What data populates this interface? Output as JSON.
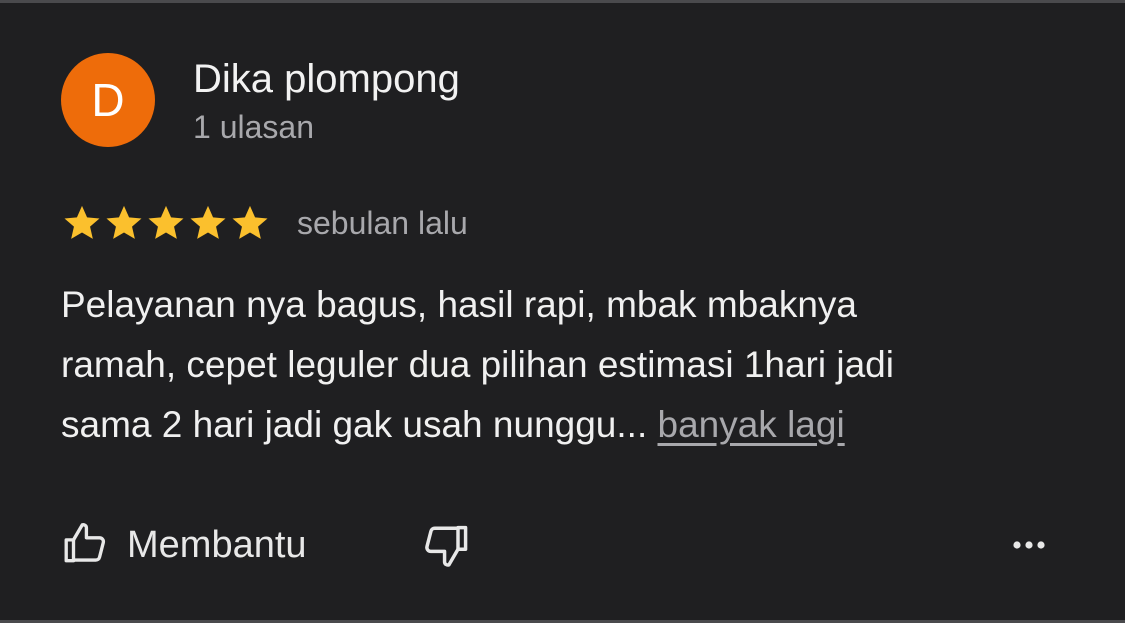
{
  "review": {
    "author": {
      "initial": "D",
      "name": "Dika plompong",
      "review_count": "1 ulasan",
      "avatar_color": "#ee6c0a"
    },
    "rating": {
      "stars": 5,
      "max": 5,
      "star_color": "#fbc02d"
    },
    "time": "sebulan lalu",
    "text_line1": "Pelayanan nya bagus, hasil rapi, mbak mbaknya",
    "text_line2": "ramah, cepet leguler dua pilihan estimasi 1hari jadi",
    "text_line3": "sama 2 hari jadi gak usah nunggu... ",
    "more_label": "banyak lagi"
  },
  "actions": {
    "helpful_label": "Membantu",
    "helpful_icon": "thumbs-up-icon",
    "dislike_icon": "thumbs-down-icon",
    "more_icon": "more-horizontal-icon"
  },
  "theme": {
    "background": "#1f1f21",
    "text_primary": "#f0f0f0",
    "text_secondary": "#a8a8ac"
  }
}
